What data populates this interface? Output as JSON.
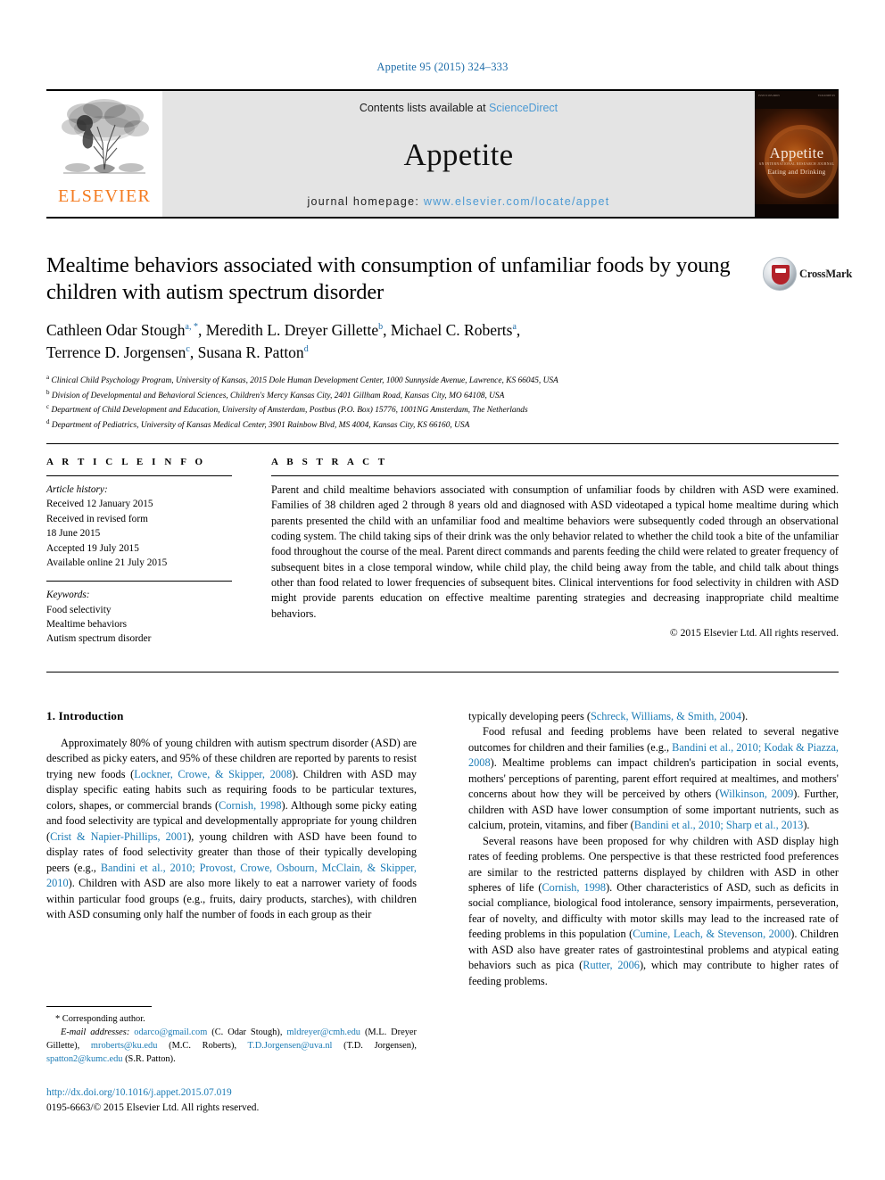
{
  "running_head": "Appetite 95 (2015) 324–333",
  "journal_header": {
    "publisher": "ELSEVIER",
    "contents_prefix": "Contents lists available at ",
    "contents_link": "ScienceDirect",
    "journal_name": "Appetite",
    "homepage_prefix": "journal homepage: ",
    "homepage_url": "www.elsevier.com/locate/appet",
    "cover": {
      "title": "Appetite",
      "sub1": "AN INTERNATIONAL RESEARCH JOURNAL",
      "sub2": "Eating and Drinking",
      "top_left": "ISSN 0195-6663",
      "top_right": "VOLUME 95"
    }
  },
  "crossmark": {
    "label": "CrossMark"
  },
  "article": {
    "title": "Mealtime behaviors associated with consumption of unfamiliar foods by young children with autism spectrum disorder",
    "authors_line1": "Cathleen Odar Stough",
    "authors": [
      {
        "name": "Cathleen Odar Stough",
        "marks": "a, *"
      },
      {
        "name": "Meredith L. Dreyer Gillette",
        "marks": "b"
      },
      {
        "name": "Michael C. Roberts",
        "marks": "a"
      },
      {
        "name": "Terrence D. Jorgensen",
        "marks": "c"
      },
      {
        "name": "Susana R. Patton",
        "marks": "d"
      }
    ],
    "affiliations": [
      {
        "mark": "a",
        "text": "Clinical Child Psychology Program, University of Kansas, 2015 Dole Human Development Center, 1000 Sunnyside Avenue, Lawrence, KS 66045, USA"
      },
      {
        "mark": "b",
        "text": "Division of Developmental and Behavioral Sciences, Children's Mercy Kansas City, 2401 Gillham Road, Kansas City, MO 64108, USA"
      },
      {
        "mark": "c",
        "text": "Department of Child Development and Education, University of Amsterdam, Postbus (P.O. Box) 15776, 1001NG Amsterdam, The Netherlands"
      },
      {
        "mark": "d",
        "text": "Department of Pediatrics, University of Kansas Medical Center, 3901 Rainbow Blvd, MS 4004, Kansas City, KS 66160, USA"
      }
    ]
  },
  "article_info": {
    "heading": "A R T I C L E   I N F O",
    "history_label": "Article history:",
    "history": [
      "Received 12 January 2015",
      "Received in revised form",
      "18 June 2015",
      "Accepted 19 July 2015",
      "Available online 21 July 2015"
    ],
    "keywords_label": "Keywords:",
    "keywords": [
      "Food selectivity",
      "Mealtime behaviors",
      "Autism spectrum disorder"
    ]
  },
  "abstract": {
    "heading": "A B S T R A C T",
    "text": "Parent and child mealtime behaviors associated with consumption of unfamiliar foods by children with ASD were examined. Families of 38 children aged 2 through 8 years old and diagnosed with ASD videotaped a typical home mealtime during which parents presented the child with an unfamiliar food and mealtime behaviors were subsequently coded through an observational coding system. The child taking sips of their drink was the only behavior related to whether the child took a bite of the unfamiliar food throughout the course of the meal. Parent direct commands and parents feeding the child were related to greater frequency of subsequent bites in a close temporal window, while child play, the child being away from the table, and child talk about things other than food related to lower frequencies of subsequent bites. Clinical interventions for food selectivity in children with ASD might provide parents education on effective mealtime parenting strategies and decreasing inappropriate child mealtime behaviors.",
    "copyright": "© 2015 Elsevier Ltd. All rights reserved."
  },
  "body": {
    "section_title": "1. Introduction",
    "left_paragraphs": [
      "Approximately 80% of young children with autism spectrum disorder (ASD) are described as picky eaters, and 95% of these children are reported by parents to resist trying new foods (Lockner, Crowe, & Skipper, 2008). Children with ASD may display specific eating habits such as requiring foods to be particular textures, colors, shapes, or commercial brands (Cornish, 1998). Although some picky eating and food selectivity are typical and developmentally appropriate for young children (Crist & Napier-Phillips, 2001), young children with ASD have been found to display rates of food selectivity greater than those of their typically developing peers (e.g., Bandini et al., 2010; Provost, Crowe, Osbourn, McClain, & Skipper, 2010). Children with ASD are also more likely to eat a narrower variety of foods within particular food groups (e.g., fruits, dairy products, starches), with children with ASD consuming only half the number of foods in each group as their"
    ],
    "right_paragraphs": [
      "typically developing peers (Schreck, Williams, & Smith, 2004).",
      "Food refusal and feeding problems have been related to several negative outcomes for children and their families (e.g., Bandini et al., 2010; Kodak & Piazza, 2008). Mealtime problems can impact children's participation in social events, mothers' perceptions of parenting, parent effort required at mealtimes, and mothers' concerns about how they will be perceived by others (Wilkinson, 2009). Further, children with ASD have lower consumption of some important nutrients, such as calcium, protein, vitamins, and fiber (Bandini et al., 2010; Sharp et al., 2013).",
      "Several reasons have been proposed for why children with ASD display high rates of feeding problems. One perspective is that these restricted food preferences are similar to the restricted patterns displayed by children with ASD in other spheres of life (Cornish, 1998). Other characteristics of ASD, such as deficits in social compliance, biological food intolerance, sensory impairments, perseveration, fear of novelty, and difficulty with motor skills may lead to the increased rate of feeding problems in this population (Cumine, Leach, & Stevenson, 2000). Children with ASD also have greater rates of gastrointestinal problems and atypical eating behaviors such as pica (Rutter, 2006), which may contribute to higher rates of feeding problems."
    ]
  },
  "footnotes": {
    "corresponding": "* Corresponding author.",
    "email_label": "E-mail addresses:",
    "emails": [
      {
        "address": "odarco@gmail.com",
        "owner": "(C. Odar Stough)"
      },
      {
        "address": "mldreyer@cmh.edu",
        "owner": "(M.L. Dreyer Gillette)"
      },
      {
        "address": "mroberts@ku.edu",
        "owner": "(M.C. Roberts)"
      },
      {
        "address": "T.D.Jorgensen@uva.nl",
        "owner": "(T.D. Jorgensen)"
      },
      {
        "address": "spatton2@kumc.edu",
        "owner": "(S.R. Patton)"
      }
    ],
    "doi": "http://dx.doi.org/10.1016/j.appet.2015.07.019",
    "issn": "0195-6663/© 2015 Elsevier Ltd. All rights reserved."
  },
  "colors": {
    "link_blue": "#1b7bb5",
    "header_blue": "#1b6ba8",
    "sciencedirect_blue": "#4c9ad4",
    "elsevier_orange": "#f47b20"
  }
}
